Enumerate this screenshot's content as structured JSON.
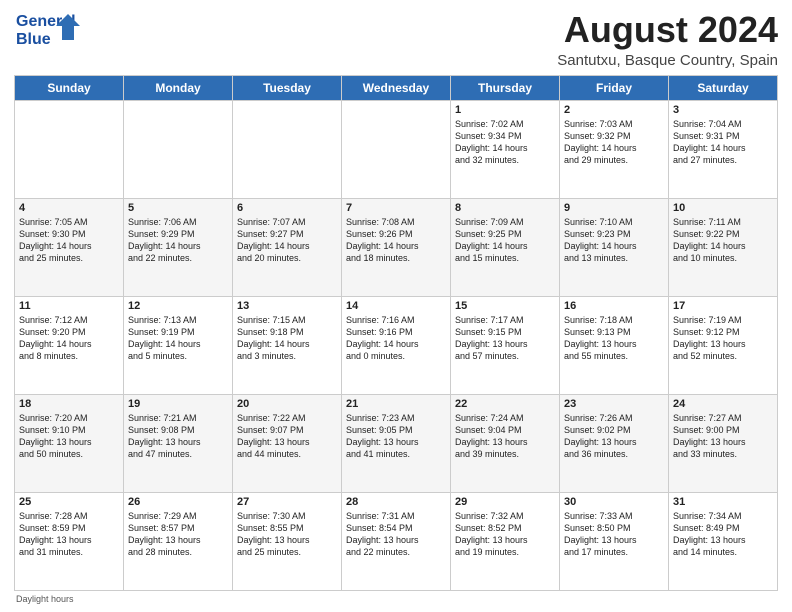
{
  "header": {
    "logo_line1": "General",
    "logo_line2": "Blue",
    "title": "August 2024",
    "subtitle": "Santutxu, Basque Country, Spain"
  },
  "days_of_week": [
    "Sunday",
    "Monday",
    "Tuesday",
    "Wednesday",
    "Thursday",
    "Friday",
    "Saturday"
  ],
  "weeks": [
    [
      {
        "day": "",
        "info": ""
      },
      {
        "day": "",
        "info": ""
      },
      {
        "day": "",
        "info": ""
      },
      {
        "day": "",
        "info": ""
      },
      {
        "day": "1",
        "info": "Sunrise: 7:02 AM\nSunset: 9:34 PM\nDaylight: 14 hours\nand 32 minutes."
      },
      {
        "day": "2",
        "info": "Sunrise: 7:03 AM\nSunset: 9:32 PM\nDaylight: 14 hours\nand 29 minutes."
      },
      {
        "day": "3",
        "info": "Sunrise: 7:04 AM\nSunset: 9:31 PM\nDaylight: 14 hours\nand 27 minutes."
      }
    ],
    [
      {
        "day": "4",
        "info": "Sunrise: 7:05 AM\nSunset: 9:30 PM\nDaylight: 14 hours\nand 25 minutes."
      },
      {
        "day": "5",
        "info": "Sunrise: 7:06 AM\nSunset: 9:29 PM\nDaylight: 14 hours\nand 22 minutes."
      },
      {
        "day": "6",
        "info": "Sunrise: 7:07 AM\nSunset: 9:27 PM\nDaylight: 14 hours\nand 20 minutes."
      },
      {
        "day": "7",
        "info": "Sunrise: 7:08 AM\nSunset: 9:26 PM\nDaylight: 14 hours\nand 18 minutes."
      },
      {
        "day": "8",
        "info": "Sunrise: 7:09 AM\nSunset: 9:25 PM\nDaylight: 14 hours\nand 15 minutes."
      },
      {
        "day": "9",
        "info": "Sunrise: 7:10 AM\nSunset: 9:23 PM\nDaylight: 14 hours\nand 13 minutes."
      },
      {
        "day": "10",
        "info": "Sunrise: 7:11 AM\nSunset: 9:22 PM\nDaylight: 14 hours\nand 10 minutes."
      }
    ],
    [
      {
        "day": "11",
        "info": "Sunrise: 7:12 AM\nSunset: 9:20 PM\nDaylight: 14 hours\nand 8 minutes."
      },
      {
        "day": "12",
        "info": "Sunrise: 7:13 AM\nSunset: 9:19 PM\nDaylight: 14 hours\nand 5 minutes."
      },
      {
        "day": "13",
        "info": "Sunrise: 7:15 AM\nSunset: 9:18 PM\nDaylight: 14 hours\nand 3 minutes."
      },
      {
        "day": "14",
        "info": "Sunrise: 7:16 AM\nSunset: 9:16 PM\nDaylight: 14 hours\nand 0 minutes."
      },
      {
        "day": "15",
        "info": "Sunrise: 7:17 AM\nSunset: 9:15 PM\nDaylight: 13 hours\nand 57 minutes."
      },
      {
        "day": "16",
        "info": "Sunrise: 7:18 AM\nSunset: 9:13 PM\nDaylight: 13 hours\nand 55 minutes."
      },
      {
        "day": "17",
        "info": "Sunrise: 7:19 AM\nSunset: 9:12 PM\nDaylight: 13 hours\nand 52 minutes."
      }
    ],
    [
      {
        "day": "18",
        "info": "Sunrise: 7:20 AM\nSunset: 9:10 PM\nDaylight: 13 hours\nand 50 minutes."
      },
      {
        "day": "19",
        "info": "Sunrise: 7:21 AM\nSunset: 9:08 PM\nDaylight: 13 hours\nand 47 minutes."
      },
      {
        "day": "20",
        "info": "Sunrise: 7:22 AM\nSunset: 9:07 PM\nDaylight: 13 hours\nand 44 minutes."
      },
      {
        "day": "21",
        "info": "Sunrise: 7:23 AM\nSunset: 9:05 PM\nDaylight: 13 hours\nand 41 minutes."
      },
      {
        "day": "22",
        "info": "Sunrise: 7:24 AM\nSunset: 9:04 PM\nDaylight: 13 hours\nand 39 minutes."
      },
      {
        "day": "23",
        "info": "Sunrise: 7:26 AM\nSunset: 9:02 PM\nDaylight: 13 hours\nand 36 minutes."
      },
      {
        "day": "24",
        "info": "Sunrise: 7:27 AM\nSunset: 9:00 PM\nDaylight: 13 hours\nand 33 minutes."
      }
    ],
    [
      {
        "day": "25",
        "info": "Sunrise: 7:28 AM\nSunset: 8:59 PM\nDaylight: 13 hours\nand 31 minutes."
      },
      {
        "day": "26",
        "info": "Sunrise: 7:29 AM\nSunset: 8:57 PM\nDaylight: 13 hours\nand 28 minutes."
      },
      {
        "day": "27",
        "info": "Sunrise: 7:30 AM\nSunset: 8:55 PM\nDaylight: 13 hours\nand 25 minutes."
      },
      {
        "day": "28",
        "info": "Sunrise: 7:31 AM\nSunset: 8:54 PM\nDaylight: 13 hours\nand 22 minutes."
      },
      {
        "day": "29",
        "info": "Sunrise: 7:32 AM\nSunset: 8:52 PM\nDaylight: 13 hours\nand 19 minutes."
      },
      {
        "day": "30",
        "info": "Sunrise: 7:33 AM\nSunset: 8:50 PM\nDaylight: 13 hours\nand 17 minutes."
      },
      {
        "day": "31",
        "info": "Sunrise: 7:34 AM\nSunset: 8:49 PM\nDaylight: 13 hours\nand 14 minutes."
      }
    ]
  ],
  "footer": "Daylight hours"
}
